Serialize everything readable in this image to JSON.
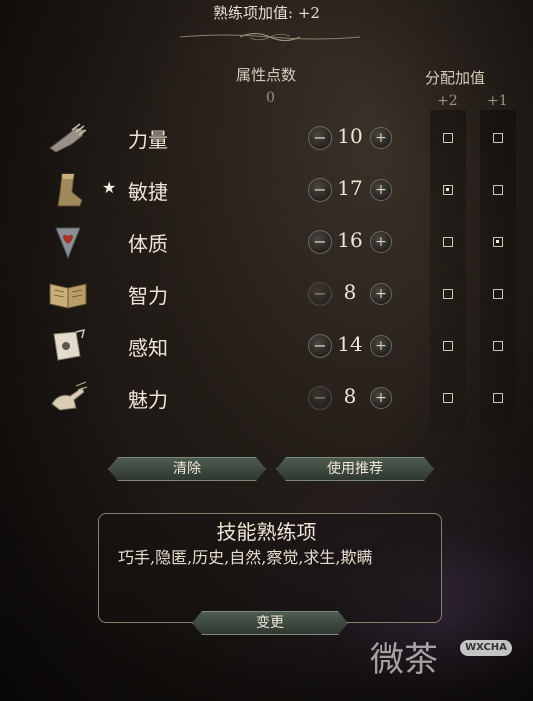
{
  "header": {
    "proficiency_bonus": "熟练项加值: +2"
  },
  "columns": {
    "points_title": "属性点数",
    "points_remaining": "0",
    "alloc_title": "分配加值",
    "alloc_plus2": "+2",
    "alloc_plus1": "+1"
  },
  "abilities": [
    {
      "label": "力量",
      "value": "10",
      "starred": false,
      "plus2": false,
      "plus1": false,
      "icon": "gauntlet-icon"
    },
    {
      "label": "敏捷",
      "value": "17",
      "starred": true,
      "star": "★",
      "plus2": true,
      "plus1": false,
      "icon": "boot-icon"
    },
    {
      "label": "体质",
      "value": "16",
      "starred": false,
      "plus2": false,
      "plus1": true,
      "icon": "heart-shield-icon"
    },
    {
      "label": "智力",
      "value": "8",
      "starred": false,
      "plus2": false,
      "plus1": false,
      "icon": "open-book-icon"
    },
    {
      "label": "感知",
      "value": "14",
      "starred": false,
      "plus2": false,
      "plus1": false,
      "icon": "scroll-icon"
    },
    {
      "label": "魅力",
      "value": "8",
      "starred": false,
      "plus2": false,
      "plus1": false,
      "icon": "hand-icon"
    }
  ],
  "buttons": {
    "reset": "清除",
    "recommended": "使用推荐",
    "change": "变更"
  },
  "skills": {
    "title": "技能熟练项",
    "list": "巧手,隐匿,历史,自然,察觉,求生,欺瞒"
  },
  "watermark": {
    "text": "微茶",
    "badge": "WXCHA"
  }
}
